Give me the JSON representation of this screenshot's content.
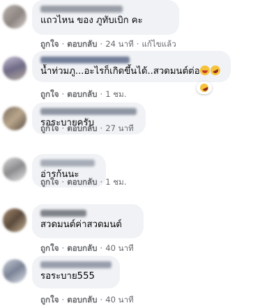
{
  "comments": [
    {
      "text": "แถวไหน ของ ภูทับเบิก คะ",
      "like": "ถูกใจ",
      "reply": "ตอบกลับ",
      "time": "24 นาที",
      "edited": "แก้ไขแล้ว"
    },
    {
      "text": "น้ำท่วมภู...อะไรก็เกิดขึ้นได้..สวดมนต์ต่อ",
      "like": "ถูกใจ",
      "reply": "ตอบกลับ",
      "time": "1 ชม.",
      "reaction_count": "1",
      "emojis": [
        "grinning-emoji",
        "rofl-emoji"
      ]
    },
    {
      "text": "รอระบายครับ",
      "like": "ถูกใจ",
      "reply": "ตอบกลับ",
      "time": "27 นาที"
    },
    {
      "text": "อ่ารก้นนะ",
      "like": "ถูกใจ",
      "reply": "ตอบกลับ",
      "time": "1 ชม."
    },
    {
      "text": "สวดมนต์ค่าสวดมนต์",
      "like": "ถูกใจ",
      "reply": "ตอบกลับ",
      "time": "40 นาที"
    },
    {
      "text": "รอระบาย555",
      "like": "ถูกใจ",
      "reply": "ตอบกลับ",
      "time": "40 นาที"
    }
  ],
  "separator": "·",
  "colors": {
    "bubble": "#f0f2f5",
    "meta_text": "#65676b",
    "body_text": "#050505"
  }
}
